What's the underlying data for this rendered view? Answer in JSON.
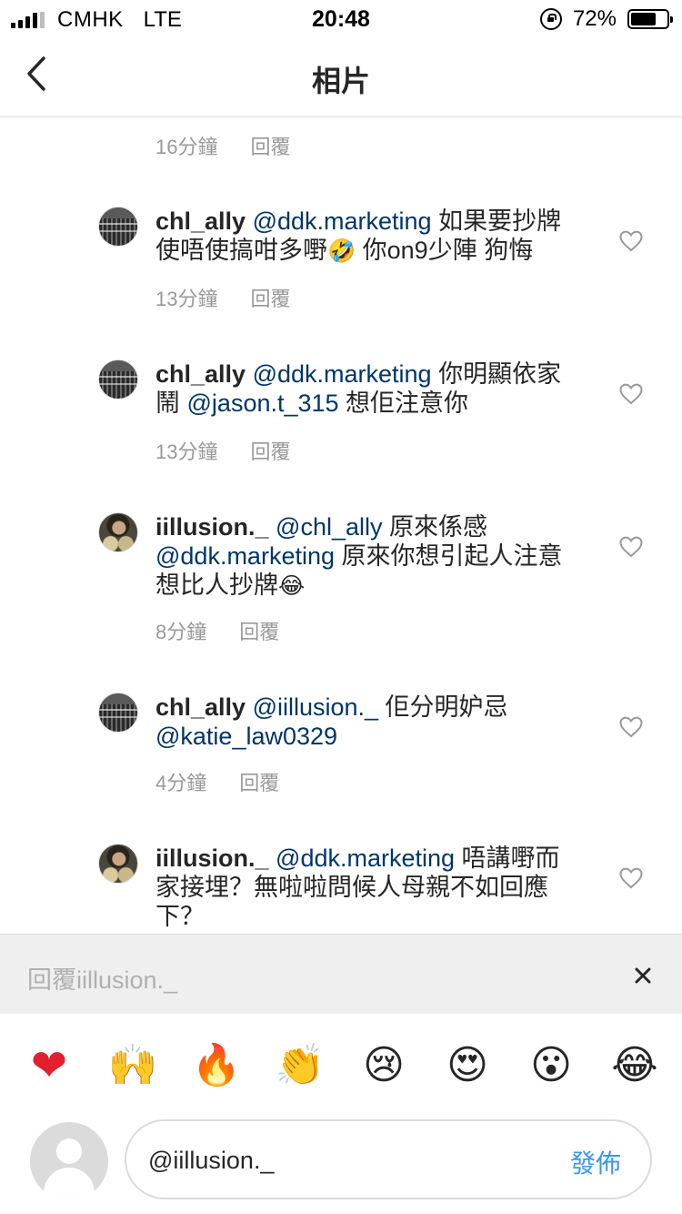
{
  "status_bar": {
    "carrier": "CMHK",
    "network": "LTE",
    "time": "20:48",
    "battery_percent": "72%",
    "battery_level": 0.72
  },
  "nav": {
    "title": "相片",
    "back_icon": "chevron-left-icon"
  },
  "comments": {
    "top_meta": {
      "time": "16分鐘",
      "reply": "回覆"
    },
    "items": [
      {
        "username": "chl_ally",
        "avatar": "building",
        "parts": [
          {
            "type": "mention",
            "text": "@ddk.marketing"
          },
          {
            "type": "text",
            "text": " 如果要抄牌使唔使搞咁多嘢"
          },
          {
            "type": "emoji",
            "text": "🤣"
          },
          {
            "type": "text",
            "text": " 你on9少陣 狗悔"
          }
        ],
        "time": "13分鐘",
        "reply": "回覆"
      },
      {
        "username": "chl_ally",
        "avatar": "building",
        "parts": [
          {
            "type": "mention",
            "text": "@ddk.marketing"
          },
          {
            "type": "text",
            "text": " 你明顯依家鬧 "
          },
          {
            "type": "mention",
            "text": "@jason.t_315"
          },
          {
            "type": "text",
            "text": " 想佢注意你"
          }
        ],
        "time": "13分鐘",
        "reply": "回覆"
      },
      {
        "username": "iillusion._",
        "avatar": "person",
        "parts": [
          {
            "type": "mention",
            "text": "@chl_ally"
          },
          {
            "type": "text",
            "text": " 原來係感 "
          },
          {
            "type": "mention",
            "text": "@ddk.marketing"
          },
          {
            "type": "text",
            "text": " 原來你想引起人注意想比人抄牌"
          },
          {
            "type": "emoji",
            "text": "😂"
          }
        ],
        "time": "8分鐘",
        "reply": "回覆"
      },
      {
        "username": "chl_ally",
        "avatar": "building",
        "parts": [
          {
            "type": "mention",
            "text": "@iillusion._"
          },
          {
            "type": "text",
            "text": "  佢分明妒忌 "
          },
          {
            "type": "mention",
            "text": "@katie_law0329"
          }
        ],
        "time": "4分鐘",
        "reply": "回覆"
      },
      {
        "username": "iillusion._",
        "avatar": "person",
        "parts": [
          {
            "type": "mention",
            "text": "@ddk.marketing"
          },
          {
            "type": "text",
            "text": " 唔講嘢而家接埋？無啦啦問候人母親不如回應下？"
          }
        ],
        "time": "",
        "reply": ""
      }
    ]
  },
  "reply_banner": {
    "text": "回覆iillusion._",
    "close_icon": "close-icon"
  },
  "emoji_bar": [
    {
      "name": "heart-emoji",
      "glyph": "❤"
    },
    {
      "name": "raising-hands-emoji",
      "glyph": "🙌"
    },
    {
      "name": "fire-emoji",
      "glyph": "🔥"
    },
    {
      "name": "clapping-hands-emoji",
      "glyph": "👏"
    },
    {
      "name": "crying-face-emoji",
      "glyph": "😢"
    },
    {
      "name": "heart-eyes-emoji",
      "glyph": "😍"
    },
    {
      "name": "surprised-face-emoji",
      "glyph": "😮"
    },
    {
      "name": "tears-of-joy-emoji",
      "glyph": "😂"
    }
  ],
  "compose": {
    "value": "@iillusion._",
    "post_label": "發佈"
  },
  "colors": {
    "mention": "#003569",
    "meta": "#999999",
    "post": "#3897f0",
    "divider": "#dbdbdb",
    "banner_bg": "#efefef"
  }
}
